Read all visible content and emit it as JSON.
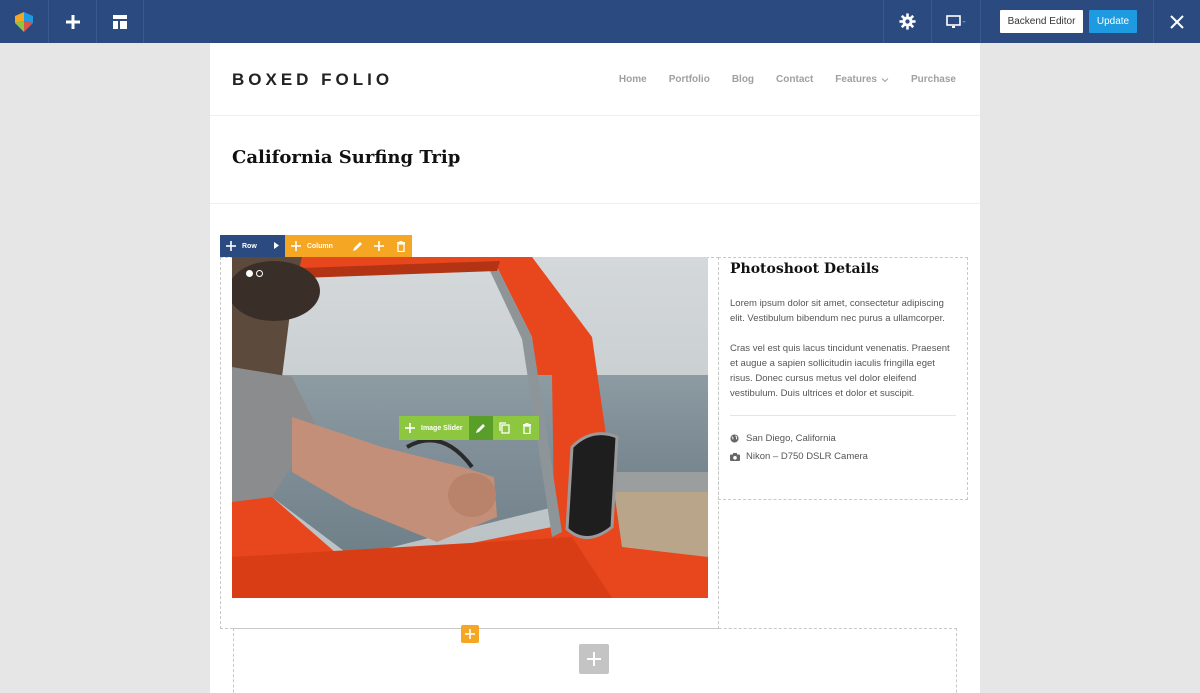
{
  "toolbar": {
    "backend_editor_label": "Backend Editor",
    "update_label": "Update"
  },
  "site": {
    "logo": "BOXED FOLIO",
    "nav": [
      "Home",
      "Portfolio",
      "Blog",
      "Contact",
      "Features",
      "Purchase"
    ]
  },
  "page_title": "California Surfing Trip",
  "controls": {
    "row_label": "Row",
    "column_label": "Column",
    "element_label": "Image Slider"
  },
  "sidebar": {
    "title": "Photoshoot Details",
    "paragraph1": "Lorem ipsum dolor sit amet, consectetur adipiscing elit. Vestibulum bibendum nec purus a ullamcorper.",
    "paragraph2": "Cras vel est quis lacus tincidunt venenatis. Praesent et augue a sapien sollicitudin iaculis fringilla eget risus. Donec cursus metus vel dolor eleifend vestibulum. Duis ultrices et dolor et suscipit.",
    "location": "San Diego, California",
    "camera": "Nikon – D750 DSLR Camera"
  },
  "colors": {
    "toolbar_bg": "#2b4b80",
    "update_btn": "#1e9be0",
    "column_ctrl": "#f5a623",
    "element_ctrl": "#8dc63f",
    "van_orange": "#e8461c"
  },
  "icons": [
    "logo-icon",
    "plus-icon",
    "layout-icon",
    "gear-icon",
    "monitor-icon",
    "close-icon",
    "pencil-icon",
    "trash-icon",
    "copy-icon",
    "globe-icon",
    "camera-icon",
    "chevron-down-icon",
    "caret-right-icon"
  ]
}
